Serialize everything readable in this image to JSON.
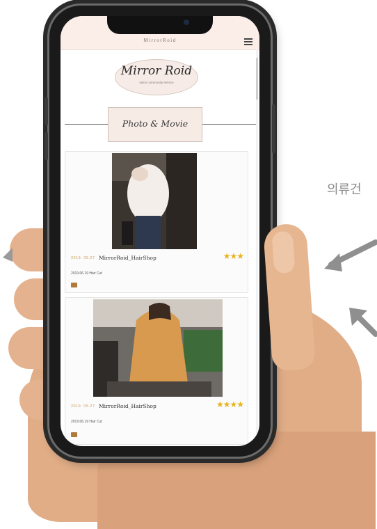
{
  "app": {
    "header_title": "MirrorRoid",
    "logo_title": "Mirror Roid",
    "logo_subtitle": "salon community service",
    "section_title": "Photo & Movie"
  },
  "posts": [
    {
      "date": "2019. 05.27",
      "shop": "MirrorRoid_HairShop",
      "stars": "★★★",
      "rating": 3,
      "service": "2019.06.19 Hair Cut"
    },
    {
      "date": "2019. 05.27",
      "shop": "MirrorRoid_HairShop",
      "stars": "★★★★",
      "rating": 4,
      "service": "2019.06.19 Hair Cut"
    }
  ],
  "background": {
    "side_text": "의류건"
  },
  "icons": {
    "menu": "hamburger-menu-icon",
    "star": "star-icon",
    "arrow": "arrow-icon"
  },
  "colors": {
    "header_bg": "#fbeee8",
    "star": "#e7b21c",
    "date": "#c9a05c",
    "tag": "#b07a3a"
  }
}
